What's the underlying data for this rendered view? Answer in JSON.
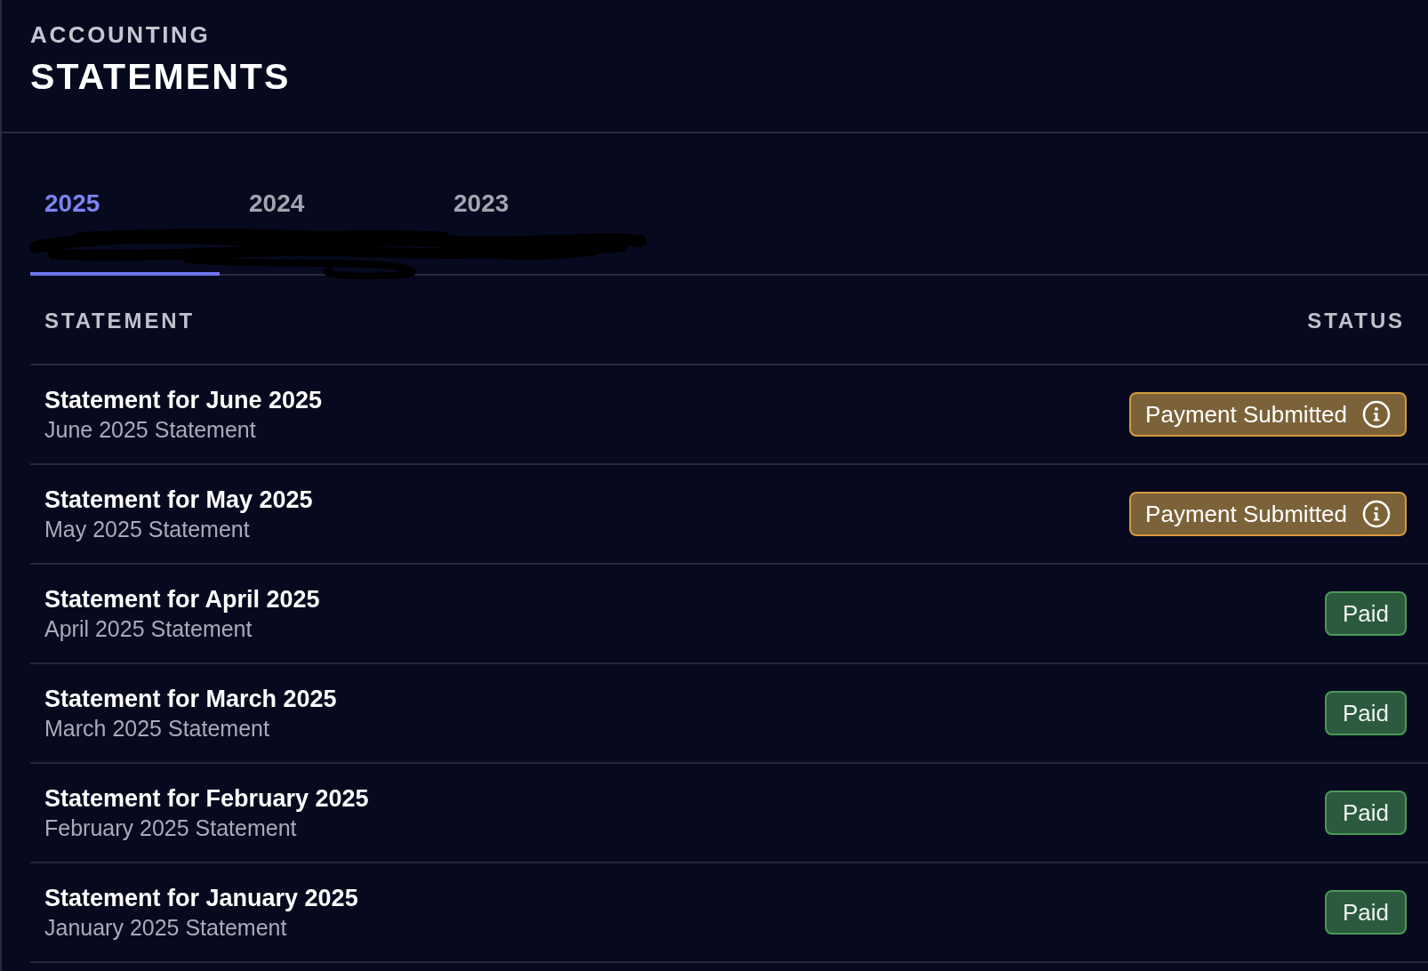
{
  "header": {
    "eyebrow": "ACCOUNTING",
    "title": "STATEMENTS"
  },
  "tabs": [
    {
      "label": "2025",
      "selected": true
    },
    {
      "label": "2024",
      "selected": false
    },
    {
      "label": "2023",
      "selected": false
    }
  ],
  "table": {
    "columns": [
      "STATEMENT",
      "STATUS"
    ],
    "rows": [
      {
        "title": "Statement for June 2025",
        "subtitle": "June 2025 Statement",
        "status": {
          "label": "Payment Submitted",
          "kind": "pending",
          "info": true
        }
      },
      {
        "title": "Statement for May 2025",
        "subtitle": "May 2025 Statement",
        "status": {
          "label": "Payment Submitted",
          "kind": "pending",
          "info": true
        }
      },
      {
        "title": "Statement for April 2025",
        "subtitle": "April 2025 Statement",
        "status": {
          "label": "Paid",
          "kind": "paid",
          "info": false
        }
      },
      {
        "title": "Statement for March 2025",
        "subtitle": "March 2025 Statement",
        "status": {
          "label": "Paid",
          "kind": "paid",
          "info": false
        }
      },
      {
        "title": "Statement for February 2025",
        "subtitle": "February 2025 Statement",
        "status": {
          "label": "Paid",
          "kind": "paid",
          "info": false
        }
      },
      {
        "title": "Statement for January 2025",
        "subtitle": "January 2025 Statement",
        "status": {
          "label": "Paid",
          "kind": "paid",
          "info": false
        }
      }
    ]
  }
}
